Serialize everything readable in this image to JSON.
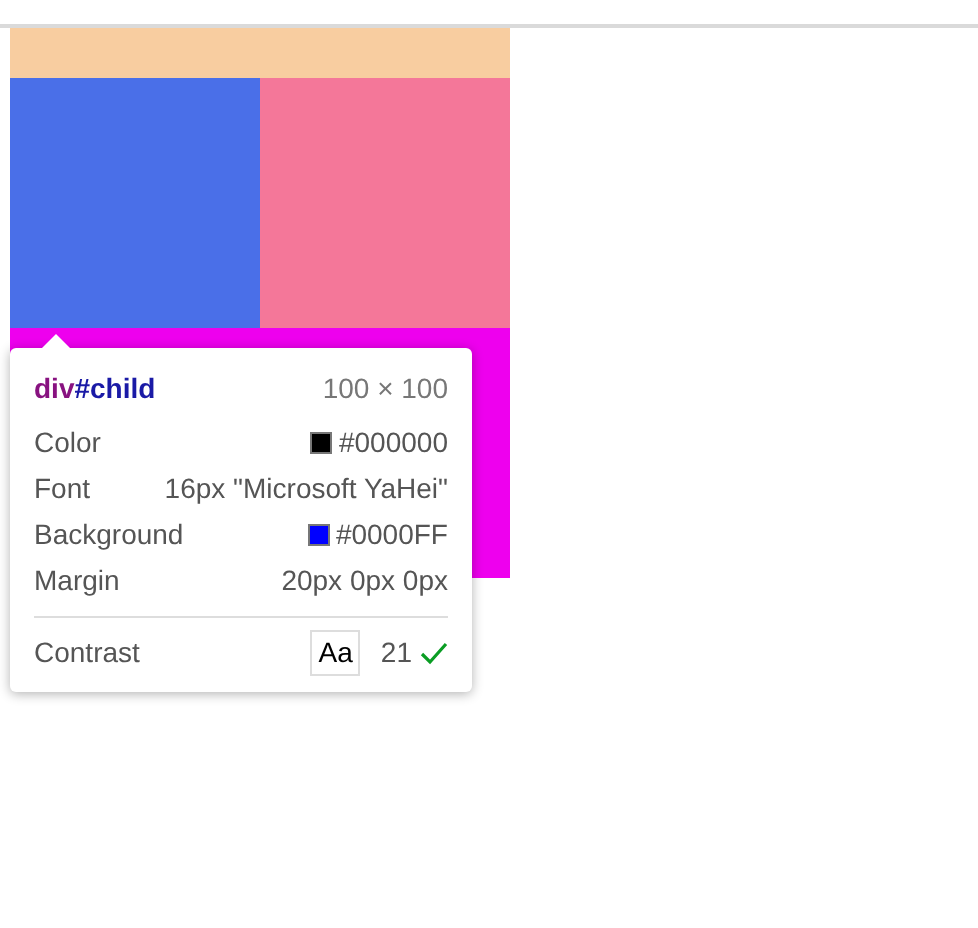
{
  "blocks": [
    {
      "color": "#f8cda0"
    },
    {
      "color": "#4a6fe8"
    },
    {
      "color": "#f47799"
    },
    {
      "color": "#ee00ee"
    }
  ],
  "tooltip": {
    "tag": "div",
    "id": "#child",
    "size": "100 × 100",
    "rows": [
      {
        "label": "Color",
        "value": "#000000",
        "color": "#000000"
      },
      {
        "label": "Font",
        "value": "16px \"Microsoft YaHei\""
      },
      {
        "label": "Background",
        "value": "#0000FF",
        "color": "#0000ff"
      },
      {
        "label": "Margin",
        "value": "20px 0px 0px"
      }
    ],
    "contrast": {
      "label": "Contrast",
      "sample": "Aa",
      "ratio": "21",
      "passing": true
    }
  }
}
